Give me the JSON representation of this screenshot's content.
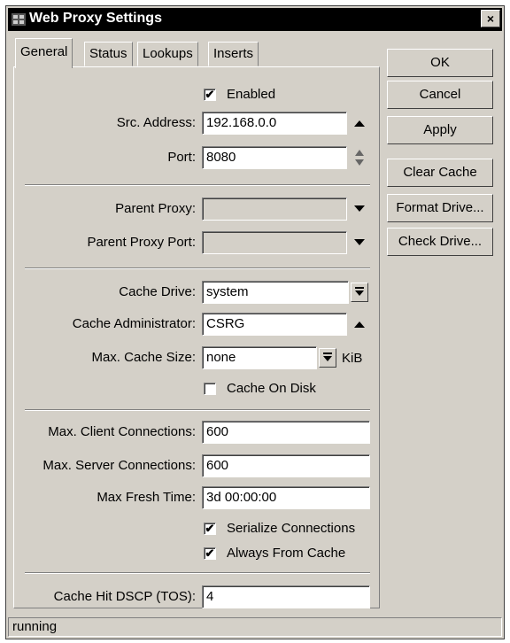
{
  "window": {
    "title": "Web Proxy Settings",
    "close_label": "×"
  },
  "tabs": [
    {
      "label": "General"
    },
    {
      "label": "Status"
    },
    {
      "label": "Lookups"
    },
    {
      "label": "Inserts"
    }
  ],
  "general": {
    "enabled_label": "Enabled",
    "src_address_label": "Src. Address:",
    "src_address_value": "192.168.0.0",
    "port_label": "Port:",
    "port_value": "8080",
    "parent_proxy_label": "Parent Proxy:",
    "parent_proxy_value": "",
    "parent_proxy_port_label": "Parent Proxy Port:",
    "parent_proxy_port_value": "",
    "cache_drive_label": "Cache Drive:",
    "cache_drive_value": "system",
    "cache_admin_label": "Cache Administrator:",
    "cache_admin_value": "CSRG",
    "max_cache_size_label": "Max. Cache Size:",
    "max_cache_size_value": "none",
    "max_cache_size_unit": "KiB",
    "cache_on_disk_label": "Cache On Disk",
    "max_client_conn_label": "Max. Client Connections:",
    "max_client_conn_value": "600",
    "max_server_conn_label": "Max. Server Connections:",
    "max_server_conn_value": "600",
    "max_fresh_time_label": "Max Fresh Time:",
    "max_fresh_time_value": "3d 00:00:00",
    "serialize_label": "Serialize Connections",
    "always_from_cache_label": "Always From Cache",
    "cache_hit_dscp_label": "Cache Hit DSCP (TOS):",
    "cache_hit_dscp_value": "4"
  },
  "checkbox_states": {
    "enabled": true,
    "cache_on_disk": false,
    "serialize": true,
    "always_from_cache": true
  },
  "buttons": {
    "ok": "OK",
    "cancel": "Cancel",
    "apply": "Apply",
    "clear_cache": "Clear Cache",
    "format_drive": "Format Drive...",
    "check_drive": "Check Drive..."
  },
  "status_bar": {
    "text": "running"
  }
}
